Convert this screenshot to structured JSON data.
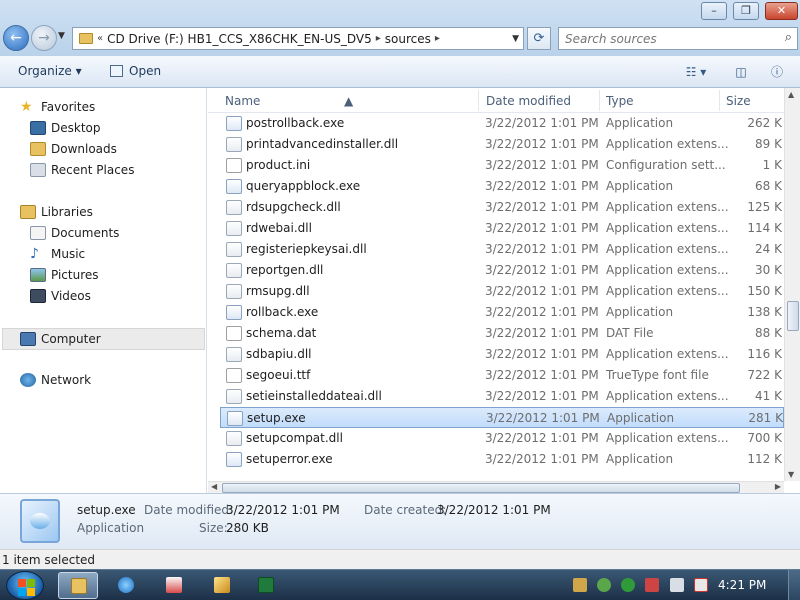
{
  "window": {
    "controls": [
      "minimize",
      "maximize",
      "close"
    ]
  },
  "nav": {
    "address_chevron": "«",
    "address_segments": [
      "CD Drive (F:) HB1_CCS_X86CHK_EN-US_DV5",
      "sources"
    ],
    "search_placeholder": "Search sources"
  },
  "toolbar": {
    "organize_label": "Organize ▾",
    "open_label": "Open"
  },
  "sidebar": {
    "favorites": {
      "label": "Favorites",
      "items": [
        "Desktop",
        "Downloads",
        "Recent Places"
      ]
    },
    "libraries": {
      "label": "Libraries",
      "items": [
        "Documents",
        "Music",
        "Pictures",
        "Videos"
      ]
    },
    "computer_label": "Computer",
    "network_label": "Network"
  },
  "columns": [
    "Name",
    "Date modified",
    "Type",
    "Size"
  ],
  "files": [
    {
      "name": "postrollback.exe",
      "date": "3/22/2012 1:01 PM",
      "type": "Application",
      "size": "262 K",
      "icon": "exe-icon"
    },
    {
      "name": "printadvancedinstaller.dll",
      "date": "3/22/2012 1:01 PM",
      "type": "Application extens...",
      "size": "89 K",
      "icon": "dll-icon"
    },
    {
      "name": "product.ini",
      "date": "3/22/2012 1:01 PM",
      "type": "Configuration sett...",
      "size": "1 K",
      "icon": "ini-icon"
    },
    {
      "name": "queryappblock.exe",
      "date": "3/22/2012 1:01 PM",
      "type": "Application",
      "size": "68 K",
      "icon": "exe-icon"
    },
    {
      "name": "rdsupgcheck.dll",
      "date": "3/22/2012 1:01 PM",
      "type": "Application extens...",
      "size": "125 K",
      "icon": "dll-icon"
    },
    {
      "name": "rdwebai.dll",
      "date": "3/22/2012 1:01 PM",
      "type": "Application extens...",
      "size": "114 K",
      "icon": "dll-icon"
    },
    {
      "name": "registeriepkeysai.dll",
      "date": "3/22/2012 1:01 PM",
      "type": "Application extens...",
      "size": "24 K",
      "icon": "dll-icon"
    },
    {
      "name": "reportgen.dll",
      "date": "3/22/2012 1:01 PM",
      "type": "Application extens...",
      "size": "30 K",
      "icon": "dll-icon"
    },
    {
      "name": "rmsupg.dll",
      "date": "3/22/2012 1:01 PM",
      "type": "Application extens...",
      "size": "150 K",
      "icon": "dll-icon"
    },
    {
      "name": "rollback.exe",
      "date": "3/22/2012 1:01 PM",
      "type": "Application",
      "size": "138 K",
      "icon": "exe-icon"
    },
    {
      "name": "schema.dat",
      "date": "3/22/2012 1:01 PM",
      "type": "DAT File",
      "size": "88 K",
      "icon": "file-icon"
    },
    {
      "name": "sdbapiu.dll",
      "date": "3/22/2012 1:01 PM",
      "type": "Application extens...",
      "size": "116 K",
      "icon": "dll-icon"
    },
    {
      "name": "segoeui.ttf",
      "date": "3/22/2012 1:01 PM",
      "type": "TrueType font file",
      "size": "722 K",
      "icon": "font-icon"
    },
    {
      "name": "setieinstalleddateai.dll",
      "date": "3/22/2012 1:01 PM",
      "type": "Application extens...",
      "size": "41 K",
      "icon": "dll-icon"
    },
    {
      "name": "setup.exe",
      "date": "3/22/2012 1:01 PM",
      "type": "Application",
      "size": "281 K",
      "icon": "exe-icon",
      "selected": true
    },
    {
      "name": "setupcompat.dll",
      "date": "3/22/2012 1:01 PM",
      "type": "Application extens...",
      "size": "700 K",
      "icon": "dll-icon"
    },
    {
      "name": "setuperror.exe",
      "date": "3/22/2012 1:01 PM",
      "type": "Application",
      "size": "112 K",
      "icon": "exe-icon"
    }
  ],
  "details": {
    "name": "setup.exe",
    "kind": "Application",
    "date_modified_label": "Date modified:",
    "date_modified": "3/22/2012 1:01 PM",
    "size_label": "Size:",
    "size": "280 KB",
    "date_created_label": "Date created:",
    "date_created": "3/22/2012 1:01 PM"
  },
  "status": {
    "text": "1 item selected"
  },
  "taskbar": {
    "clock": "4:21 PM",
    "pinned": [
      "explorer-icon",
      "internet-explorer-icon",
      "media-icon",
      "paint-icon",
      "excel-icon"
    ]
  },
  "colors": {
    "selection": "#c1dcfc",
    "selection_border": "#7da2ce",
    "header_text": "#4c607a"
  }
}
